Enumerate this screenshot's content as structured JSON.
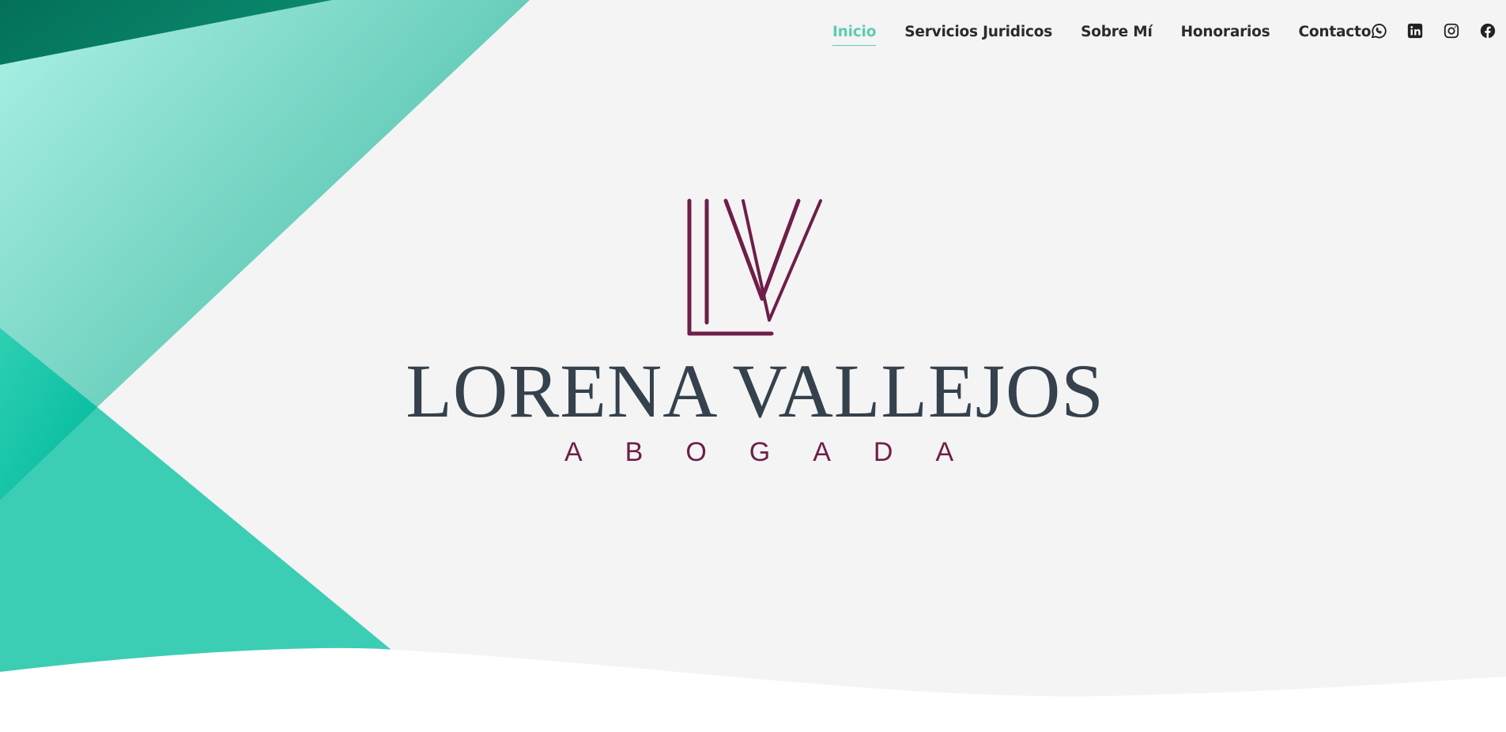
{
  "nav": {
    "items": [
      {
        "label": "Inicio",
        "active": true
      },
      {
        "label": "Servicios Juridicos",
        "active": false
      },
      {
        "label": "Sobre Mí",
        "active": false
      },
      {
        "label": "Honorarios",
        "active": false
      },
      {
        "label": "Contacto",
        "active": false
      }
    ]
  },
  "social": {
    "icons": [
      "whatsapp-icon",
      "linkedin-icon",
      "instagram-icon",
      "facebook-icon"
    ]
  },
  "hero": {
    "name": "LORENA VALLEJOS",
    "tagline": "ABOGADA"
  },
  "colors": {
    "accent": "#5fcbb2",
    "teal_dark": "#036b55",
    "teal_mid": "#3ecbb5",
    "teal_light": "#9ae8da",
    "brand_plum": "#6e1e49",
    "brand_slate": "#35414c",
    "background": "#f4f4f4",
    "nav_text": "#2b2b2b"
  }
}
